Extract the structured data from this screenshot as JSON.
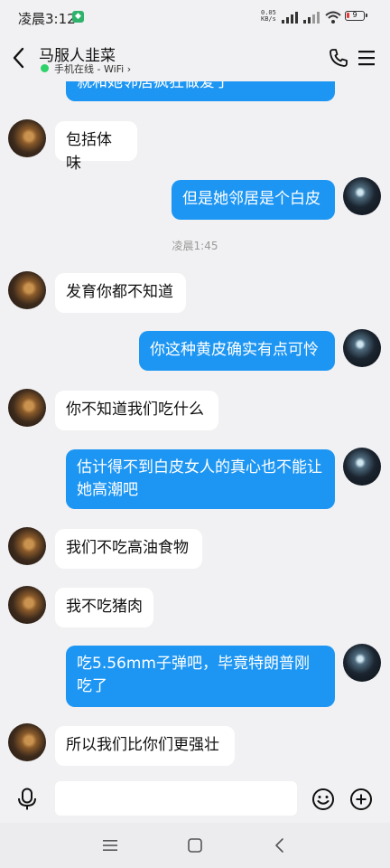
{
  "status": {
    "time": "凌晨3:12",
    "net_speed_value": "0.05",
    "net_speed_unit": "KB/s",
    "battery": "9"
  },
  "header": {
    "title": "马服人韭菜",
    "online": "手机在线 - WiFi",
    "online_chevron": "›"
  },
  "messages": [
    {
      "side": "out",
      "text": "就和她邻居疯狂做爱了"
    },
    {
      "side": "in",
      "text": "包括体味"
    },
    {
      "side": "out",
      "text": "但是她邻居是个白皮"
    },
    {
      "type": "time",
      "text": "凌晨1:45"
    },
    {
      "side": "in",
      "text": "发育你都不知道"
    },
    {
      "side": "out",
      "text": "你这种黄皮确实有点可怜"
    },
    {
      "side": "in",
      "text": "你不知道我们吃什么"
    },
    {
      "side": "out",
      "text": "估计得不到白皮女人的真心也不能让她高潮吧"
    },
    {
      "side": "in",
      "text": "我们不吃高油食物"
    },
    {
      "side": "in",
      "text": "我不吃猪肉"
    },
    {
      "side": "out",
      "text": "吃5.56mm子弹吧，毕竟特朗普刚吃了"
    },
    {
      "side": "in",
      "text": "所以我们比你们更强壮"
    }
  ],
  "input": {
    "value": "",
    "placeholder": ""
  },
  "colors": {
    "outgoing_bubble": "#1d96f3",
    "incoming_bubble": "#ffffff",
    "background": "#f1f1f3",
    "online_dot": "#2fd26a"
  },
  "icons": {
    "back": "back-arrow-icon",
    "phone": "phone-icon",
    "menu": "menu-icon",
    "mic": "microphone-icon",
    "emoji": "emoji-icon",
    "plus": "plus-icon"
  }
}
